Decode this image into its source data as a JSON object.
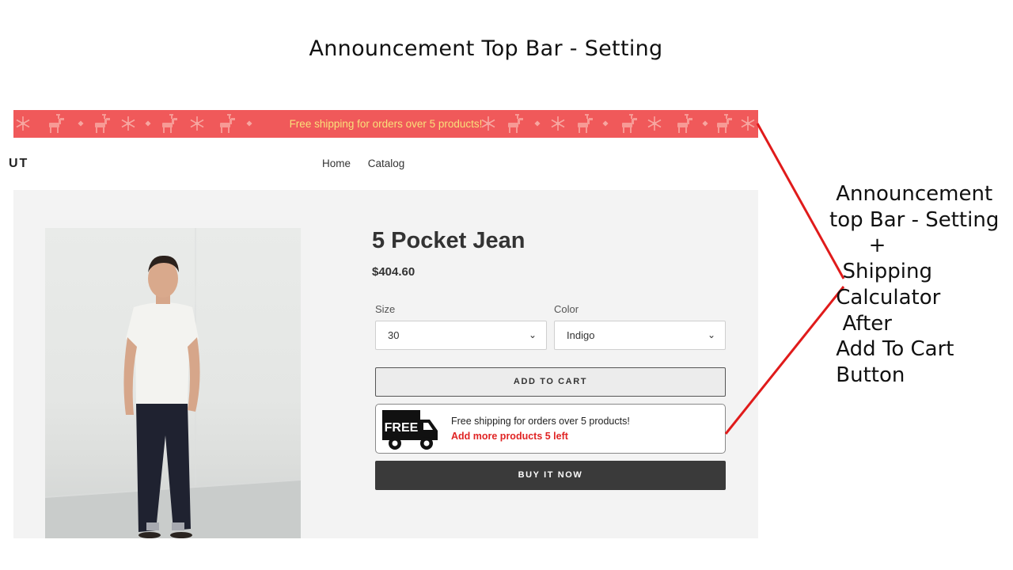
{
  "slide": {
    "title": "Announcement Top Bar - Setting"
  },
  "announcement_bar": {
    "text": "Free shipping for orders over 5 products!",
    "background": "#f0595a",
    "text_color": "#f9e07a"
  },
  "store": {
    "logo_fragment": "UT",
    "nav": [
      "Home",
      "Catalog"
    ]
  },
  "product": {
    "title": "5 Pocket Jean",
    "price": "$404.60",
    "options": [
      {
        "label": "Size",
        "value": "30"
      },
      {
        "label": "Color",
        "value": "Indigo"
      }
    ],
    "add_to_cart": "ADD TO CART",
    "buy_now": "BUY IT NOW"
  },
  "shipping_calculator": {
    "badge": "FREE",
    "icon": "truck-icon",
    "message": "Free shipping for orders over 5 products!",
    "progress": "Add more products 5 left",
    "accent": "#e02424"
  },
  "annotation": {
    "lines": [
      " Announcement",
      "top Bar - Setting",
      "      +",
      "  Shipping",
      " Calculator",
      "  After",
      " Add To Cart",
      " Button"
    ],
    "line_color": "#e01b1b"
  }
}
